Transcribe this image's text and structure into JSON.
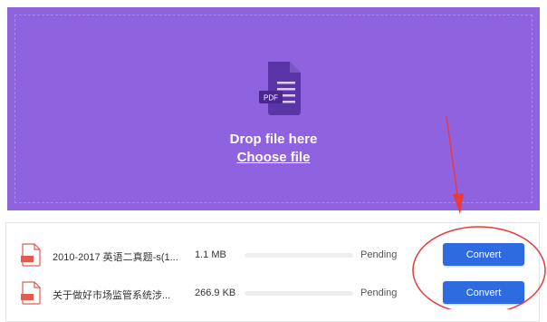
{
  "dropzone": {
    "icon_badge": "PDF",
    "drop_text": "Drop file here",
    "choose_label": "Choose file",
    "background": "#8f62e0"
  },
  "files": [
    {
      "name": "2010-2017 英语二真题-s(1...",
      "size": "1.1 MB",
      "status": "Pending",
      "progress": 0,
      "action": "Convert"
    },
    {
      "name": "关于做好市场监管系统涉...",
      "size": "266.9 KB",
      "status": "Pending",
      "progress": 0,
      "action": "Convert"
    }
  ],
  "colors": {
    "accent": "#2f6be0",
    "annotation": "#e83c3c",
    "file_icon": "#e25b4f"
  }
}
